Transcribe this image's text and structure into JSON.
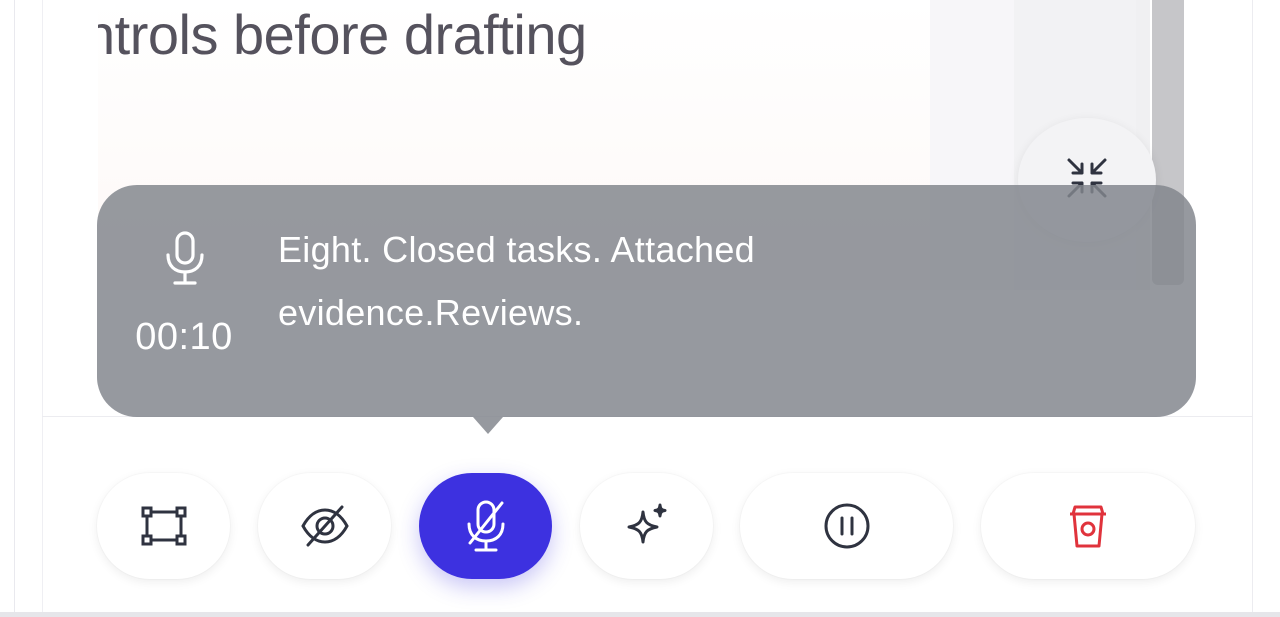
{
  "preview": {
    "heading": "ntrols before drafting"
  },
  "overlay": {
    "timer": "00:10",
    "transcript": "Eight. Closed tasks. Attached evidence.Reviews."
  },
  "toolbar": {
    "items": [
      {
        "icon": "crop-frame-icon"
      },
      {
        "icon": "eye-off-icon"
      },
      {
        "icon": "mic-off-icon",
        "active": true
      },
      {
        "icon": "sparkle-icon"
      },
      {
        "icon": "pause-icon"
      },
      {
        "icon": "trash-icon"
      }
    ]
  },
  "colors": {
    "accent": "#3d31e0",
    "danger": "#e0333c",
    "overlay": "#82858d"
  }
}
